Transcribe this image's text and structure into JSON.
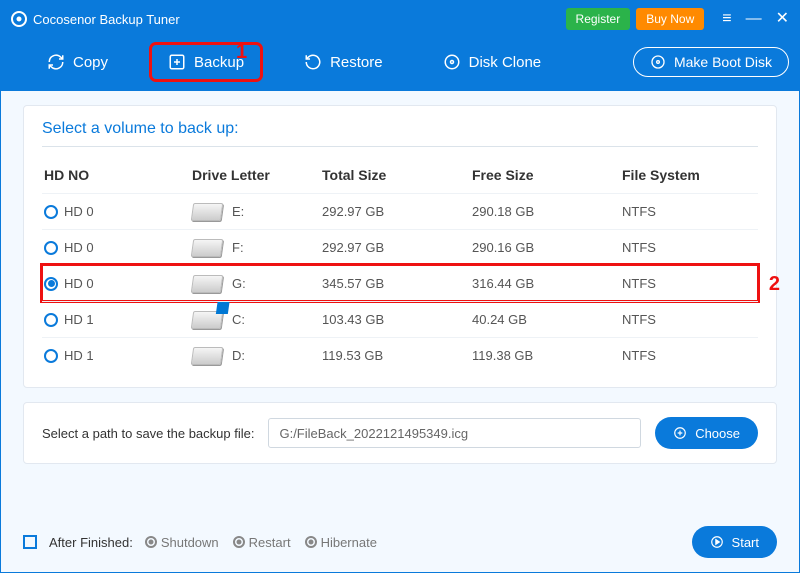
{
  "app_title": "Cocosenor Backup Tuner",
  "header": {
    "register": "Register",
    "buy": "Buy Now",
    "tabs": {
      "copy": "Copy",
      "backup": "Backup",
      "restore": "Restore",
      "diskclone": "Disk Clone"
    },
    "make_boot": "Make Boot Disk"
  },
  "callouts": {
    "one": "1",
    "two": "2"
  },
  "main": {
    "title": "Select a volume to back up:",
    "cols": {
      "hd": "HD NO",
      "drive": "Drive Letter",
      "total": "Total Size",
      "free": "Free Size",
      "fs": "File System"
    },
    "rows": [
      {
        "hd": "HD 0",
        "letter": "E:",
        "total": "292.97 GB",
        "free": "290.18 GB",
        "fs": "NTFS",
        "selected": false,
        "win": false
      },
      {
        "hd": "HD 0",
        "letter": "F:",
        "total": "292.97 GB",
        "free": "290.16 GB",
        "fs": "NTFS",
        "selected": false,
        "win": false
      },
      {
        "hd": "HD 0",
        "letter": "G:",
        "total": "345.57 GB",
        "free": "316.44 GB",
        "fs": "NTFS",
        "selected": true,
        "win": false
      },
      {
        "hd": "HD 1",
        "letter": "C:",
        "total": "103.43 GB",
        "free": "40.24 GB",
        "fs": "NTFS",
        "selected": false,
        "win": true
      },
      {
        "hd": "HD 1",
        "letter": "D:",
        "total": "119.53 GB",
        "free": "119.38 GB",
        "fs": "NTFS",
        "selected": false,
        "win": false
      }
    ]
  },
  "path": {
    "label": "Select a path to save the backup file:",
    "value": "G:/FileBack_2022121495349.icg",
    "choose": "Choose"
  },
  "footer": {
    "after": "After Finished:",
    "shutdown": "Shutdown",
    "restart": "Restart",
    "hibernate": "Hibernate",
    "start": "Start"
  }
}
